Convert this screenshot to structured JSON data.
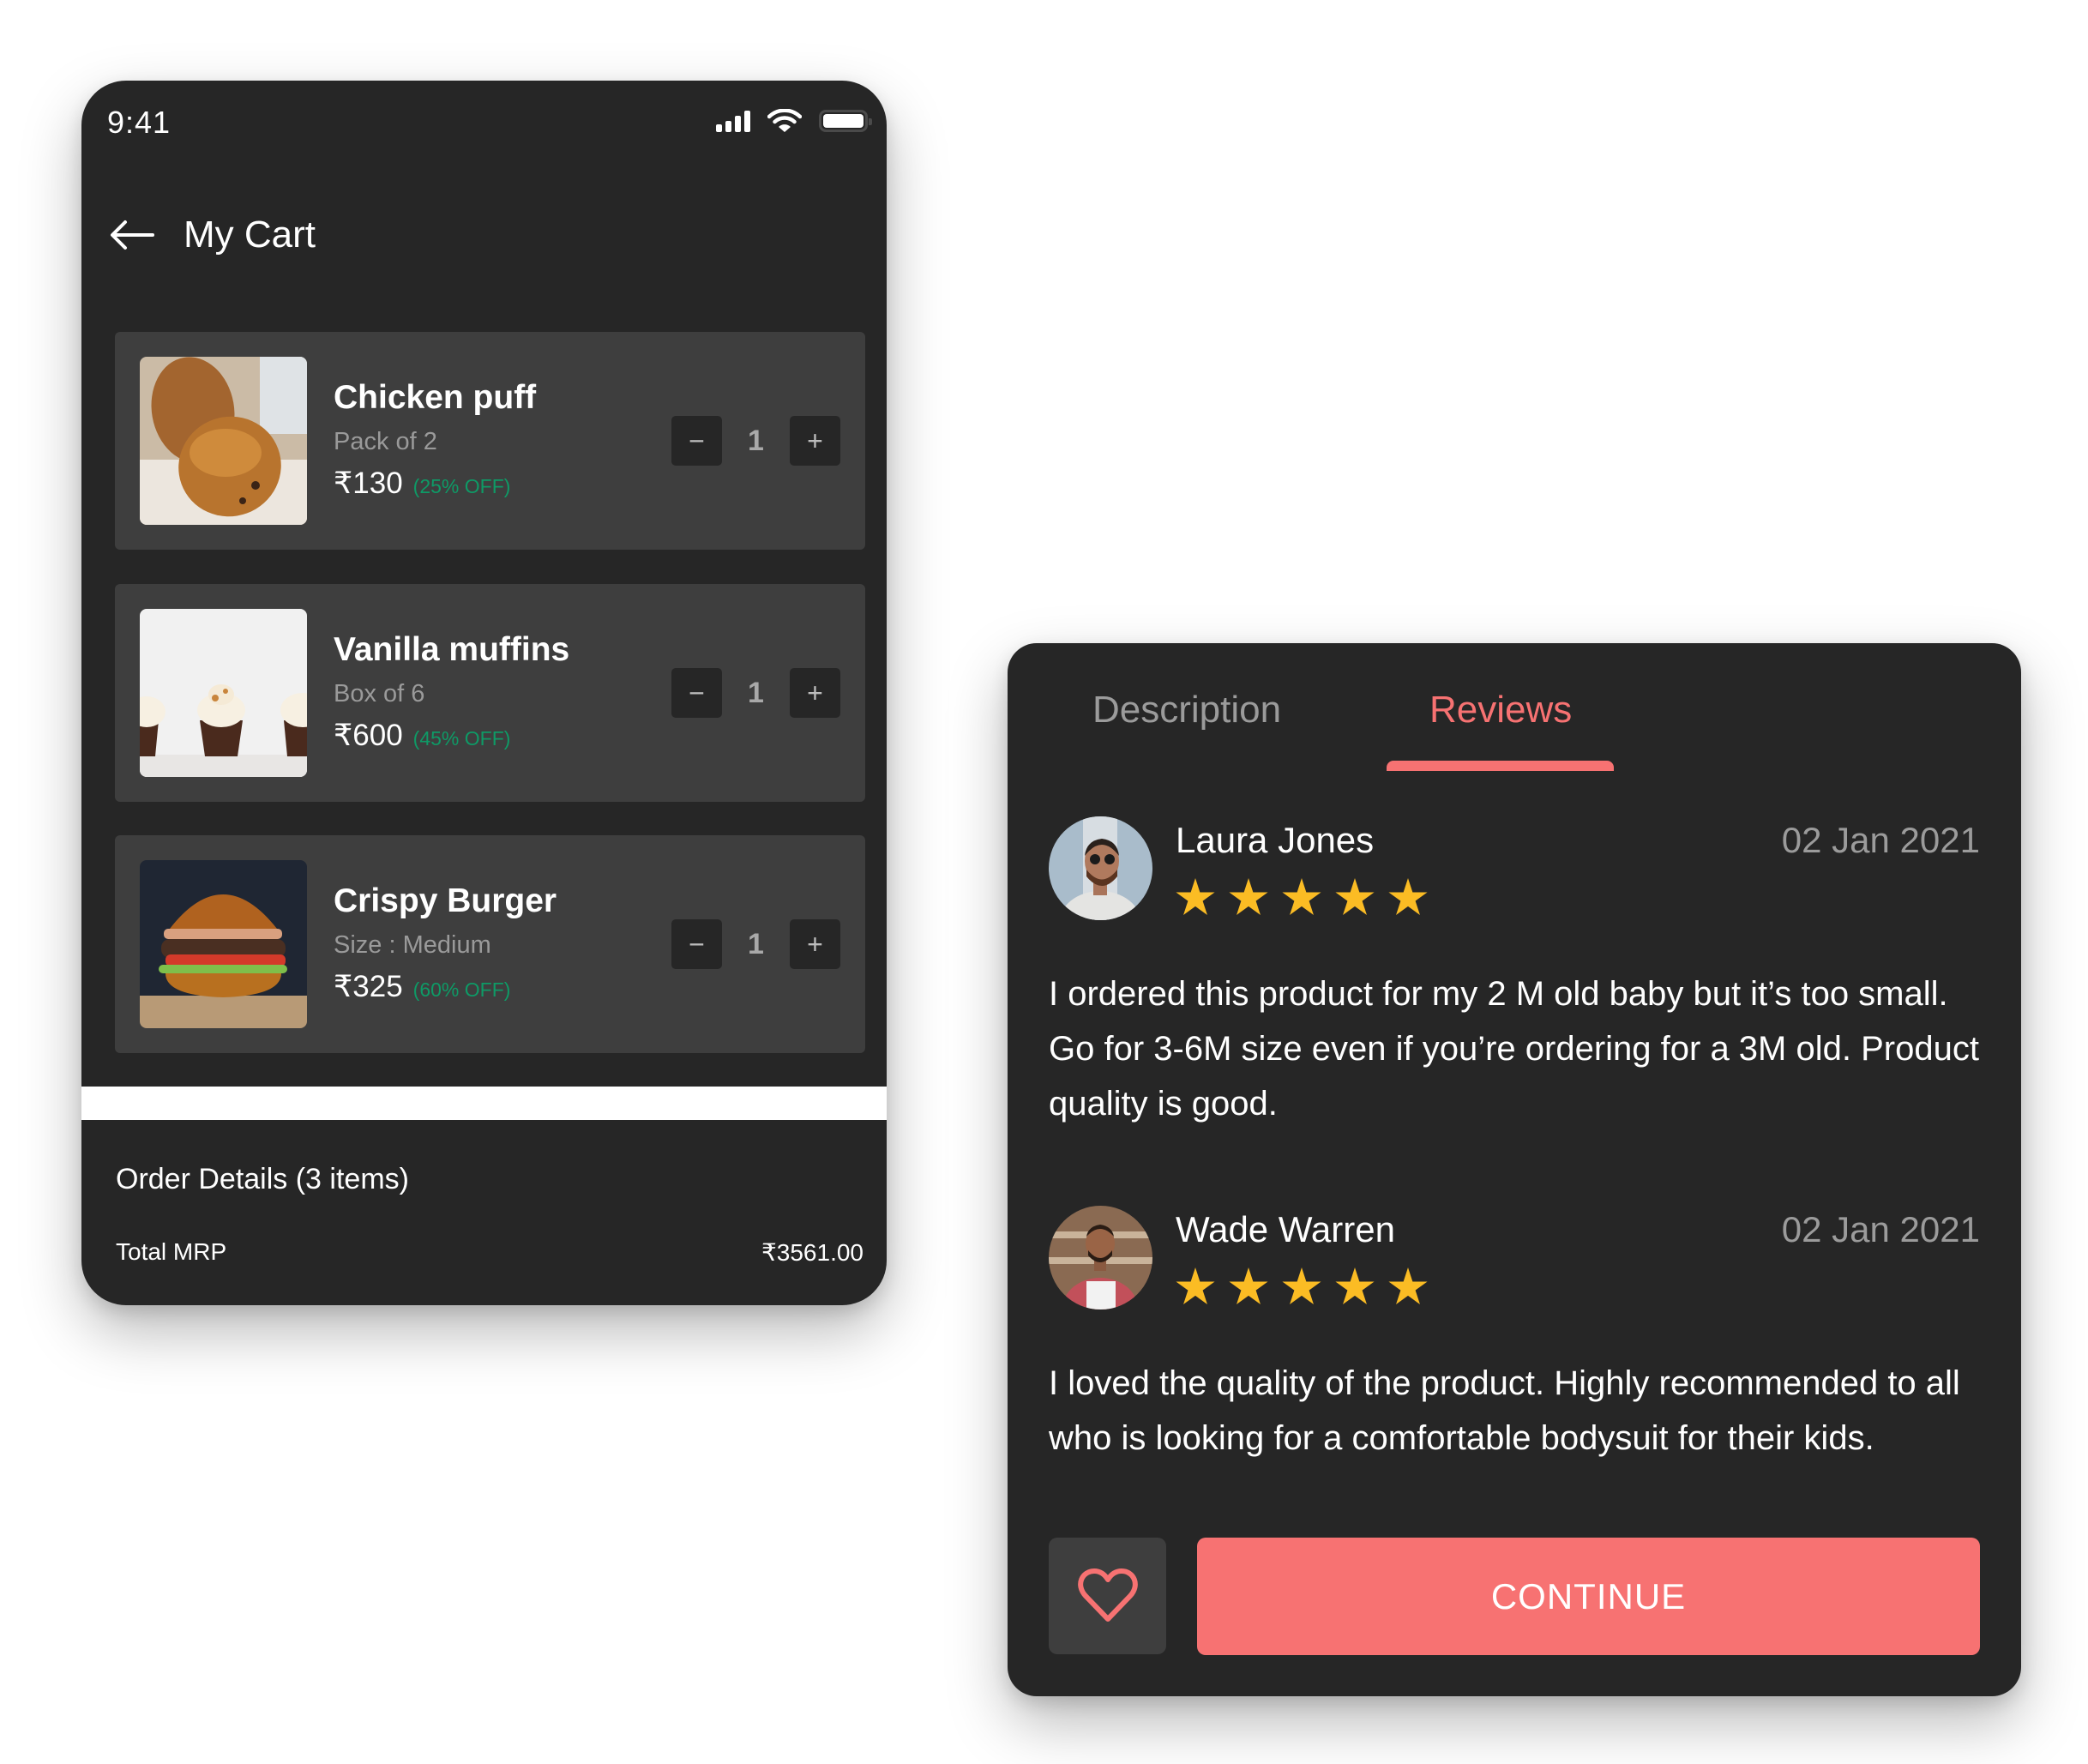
{
  "status_bar": {
    "time": "9:41"
  },
  "cart": {
    "title": "My Cart",
    "items": [
      {
        "name": "Chicken puff",
        "subtitle": "Pack of 2",
        "price": "₹130",
        "discount": "(25% OFF)",
        "quantity": "1",
        "image": "croissant-pastry-photo"
      },
      {
        "name": "Vanilla muffins",
        "subtitle": "Box of 6",
        "price": "₹600",
        "discount": "(45% OFF)",
        "quantity": "1",
        "image": "cupcakes-photo"
      },
      {
        "name": "Crispy Burger",
        "subtitle": "Size : Medium",
        "price": "₹325",
        "discount": "(60% OFF)",
        "quantity": "1",
        "image": "burger-photo"
      }
    ],
    "stepper": {
      "minus": "−",
      "plus": "+"
    },
    "order_details": {
      "title": "Order Details (3 items)",
      "total_mrp_label": "Total MRP",
      "total_mrp_value": "₹3561.00"
    }
  },
  "product_panel": {
    "tabs": [
      {
        "label": "Description",
        "active": false
      },
      {
        "label": "Reviews",
        "active": true
      }
    ],
    "reviews": [
      {
        "name": "Laura Jones",
        "date": "02 Jan 2021",
        "rating": 5,
        "max_rating": 5,
        "text": "I ordered this product for my 2 M old baby but it’s too small. Go for 3-6M size even if you’re ordering for a 3M old. Product quality is good."
      },
      {
        "name": "Wade Warren",
        "date": "02 Jan 2021",
        "rating": 5,
        "max_rating": 5,
        "text": "I loved the quality of the product. Highly recommended to all who is looking for a comfortable bodysuit for their kids."
      }
    ],
    "continue_label": "CONTINUE"
  },
  "colors": {
    "background": "#262626",
    "card": "#3e3e3e",
    "accent": "#f77272",
    "discount_green": "#0e9a66",
    "star": "#fbbc24",
    "muted_text": "#9b9b9b"
  }
}
